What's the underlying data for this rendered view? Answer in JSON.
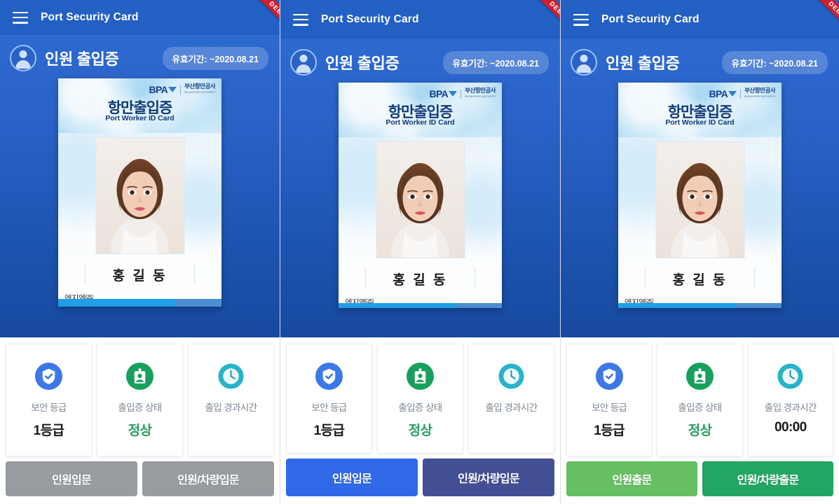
{
  "app": {
    "appbar_title": "Port Security Card",
    "menu_icon": "hamburger-menu-icon",
    "ribbon_label": "DEBUG",
    "hero_title": "인원 출입증",
    "valid_label": "유효기간: ~2020.08.21",
    "avatar_icon": "person-avatar-icon"
  },
  "id_card": {
    "brand_mark": "BPA",
    "brand_org": "부산항만공사",
    "brand_org_sub": "BUSAN PORT AUTHORITY",
    "title_kr": "항만출입증",
    "title_en": "Port Worker ID Card",
    "holder_name": "홍 길 동",
    "company": "엔지엘㈜",
    "photo_icon": "id-portrait-photo"
  },
  "info_cards": [
    {
      "icon": "shield-check-icon",
      "icon_color": "#3c78e8",
      "label": "보안 등급",
      "value": "1등급",
      "value_style": "dark"
    },
    {
      "icon": "id-badge-icon",
      "icon_color": "#16a05c",
      "label": "출입증 상태",
      "value": "정상",
      "value_style": "green"
    },
    {
      "icon": "clock-icon",
      "icon_color": "#26b3cc",
      "label": "출입 경과시간",
      "value": "",
      "value_style": "dark"
    }
  ],
  "screens": [
    {
      "id": "screen-disabled",
      "elapsed_value": "",
      "buttons": [
        {
          "label": "인원입문",
          "style": "gray"
        },
        {
          "label": "인원/차량입문",
          "style": "gray"
        }
      ]
    },
    {
      "id": "screen-entry",
      "elapsed_value": "",
      "buttons": [
        {
          "label": "인원입문",
          "style": "blue"
        },
        {
          "label": "인원/차량입문",
          "style": "navy"
        }
      ]
    },
    {
      "id": "screen-exit",
      "elapsed_value": "00:00",
      "buttons": [
        {
          "label": "인원출문",
          "style": "lgreen"
        },
        {
          "label": "인원/차량출문",
          "style": "dgreen"
        }
      ]
    }
  ],
  "colors": {
    "appbar": "#2360c4",
    "hero_top": "#2d6ad0",
    "hero_bottom": "#17499f",
    "ribbon": "#cc1f2f",
    "btn_gray": "#989ca1",
    "btn_blue": "#3069e8",
    "btn_navy": "#434f94",
    "btn_lgreen": "#66bf63",
    "btn_dgreen": "#23a662",
    "status_green": "#23a062"
  }
}
